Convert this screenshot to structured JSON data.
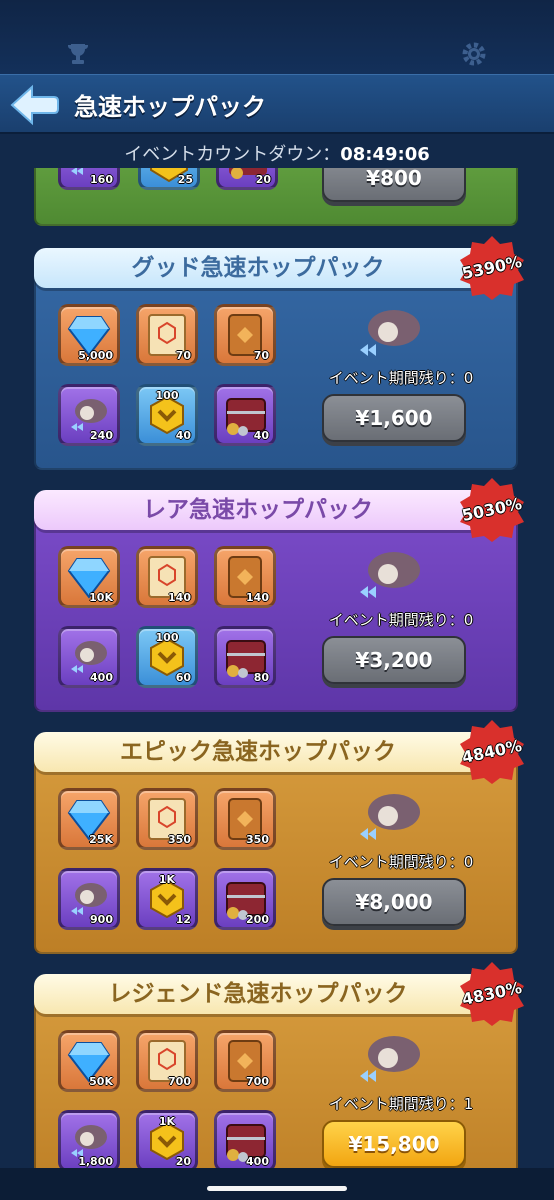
{
  "top": {
    "trophy_icon": "trophy-icon",
    "settings_icon": "gear-icon"
  },
  "header": {
    "title": "急速ホップパック",
    "back_icon": "back-arrow-icon"
  },
  "countdown": {
    "label": "イベントカウントダウン：",
    "time": "08:49:06"
  },
  "partial_pack": {
    "items": [
      "160",
      "25",
      "20"
    ],
    "price": "¥800"
  },
  "packs": [
    {
      "name": "グッド急速ホップパック",
      "badge": "5390%",
      "theme": "blue",
      "items": [
        {
          "icon": "gem-icon",
          "qty": "5,000"
        },
        {
          "icon": "scroll-icon",
          "qty": "70"
        },
        {
          "icon": "book-icon",
          "qty": "70"
        },
        {
          "icon": "dragon-hourglass-icon",
          "qty": "240"
        },
        {
          "icon": "hex-token-icon",
          "qty": "40",
          "top": "100"
        },
        {
          "icon": "treasure-chest-icon",
          "qty": "40"
        }
      ],
      "remaining": "イベント期間残り：0",
      "price": "¥1,600",
      "button": "gray"
    },
    {
      "name": "レア急速ホップパック",
      "badge": "5030%",
      "theme": "purple",
      "items": [
        {
          "icon": "gem-icon",
          "qty": "10K"
        },
        {
          "icon": "scroll-icon",
          "qty": "140"
        },
        {
          "icon": "book-icon",
          "qty": "140"
        },
        {
          "icon": "dragon-hourglass-icon",
          "qty": "400"
        },
        {
          "icon": "hex-token-icon",
          "qty": "60",
          "top": "100"
        },
        {
          "icon": "treasure-chest-icon",
          "qty": "80"
        }
      ],
      "remaining": "イベント期間残り：0",
      "price": "¥3,200",
      "button": "gray"
    },
    {
      "name": "エピック急速ホップパック",
      "badge": "4840%",
      "theme": "gold",
      "items": [
        {
          "icon": "gem-icon",
          "qty": "25K"
        },
        {
          "icon": "scroll-icon",
          "qty": "350"
        },
        {
          "icon": "book-icon",
          "qty": "350"
        },
        {
          "icon": "dragon-hourglass-icon",
          "qty": "900"
        },
        {
          "icon": "hex-token-icon",
          "qty": "12",
          "top": "1K"
        },
        {
          "icon": "treasure-chest-icon",
          "qty": "200"
        }
      ],
      "remaining": "イベント期間残り：0",
      "price": "¥8,000",
      "button": "gray"
    },
    {
      "name": "レジェンド急速ホップパック",
      "badge": "4830%",
      "theme": "gold",
      "items": [
        {
          "icon": "gem-icon",
          "qty": "50K"
        },
        {
          "icon": "scroll-icon",
          "qty": "700"
        },
        {
          "icon": "book-icon",
          "qty": "700"
        },
        {
          "icon": "dragon-hourglass-icon",
          "qty": "1,800"
        },
        {
          "icon": "hex-token-icon",
          "qty": "20",
          "top": "1K"
        },
        {
          "icon": "treasure-chest-icon",
          "qty": "400"
        }
      ],
      "remaining": "イベント期間残り：1",
      "price": "¥15,800",
      "button": "gold"
    }
  ],
  "colors": {
    "blue_body": "#2f5d96",
    "purple_body": "#6a3fb8",
    "gold_body": "#c88a2e",
    "green_body": "#5c9a3c",
    "badge_red": "#d9302c"
  }
}
